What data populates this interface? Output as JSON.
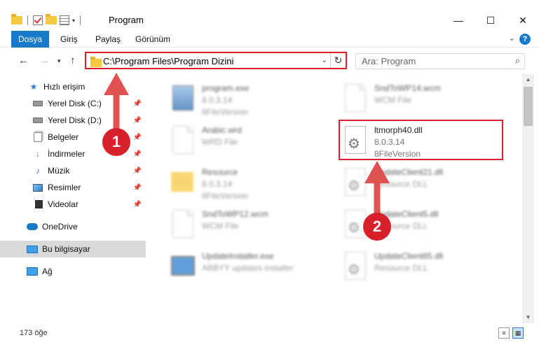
{
  "window": {
    "title": "Program"
  },
  "ribbon": {
    "tabs": [
      "Dosya",
      "Giriş",
      "Paylaş",
      "Görünüm"
    ],
    "help": "?"
  },
  "address": {
    "path": "C:\\Program Files\\Program Dizini"
  },
  "search": {
    "placeholder": "Ara: Program"
  },
  "sidebar": {
    "items": [
      {
        "label": "Hızlı erişim",
        "icon": "star-icon"
      },
      {
        "label": "Yerel Disk (C:)",
        "icon": "drive-icon",
        "pinned": true
      },
      {
        "label": "Yerel Disk (D:)",
        "icon": "drive-icon",
        "pinned": true
      },
      {
        "label": "Belgeler",
        "icon": "documents-icon",
        "pinned": true
      },
      {
        "label": "İndirmeler",
        "icon": "download-icon",
        "pinned": true
      },
      {
        "label": "Müzik",
        "icon": "music-icon",
        "pinned": true
      },
      {
        "label": "Resimler",
        "icon": "pictures-icon",
        "pinned": true
      },
      {
        "label": "Videolar",
        "icon": "videos-icon",
        "pinned": true
      },
      {
        "label": "OneDrive",
        "icon": "cloud-icon"
      },
      {
        "label": "Bu bilgisayar",
        "icon": "computer-icon",
        "selected": true
      },
      {
        "label": "Ağ",
        "icon": "network-icon"
      }
    ]
  },
  "files": [
    {
      "name": "program.exe",
      "line2": "8.0.3.14",
      "line3": "8FileVersion"
    },
    {
      "name": "SndToWP14.wcm",
      "line2": "WCM File",
      "line3": ""
    },
    {
      "name": "Arabic.wrd",
      "line2": "WRD File",
      "line3": ""
    },
    {
      "name": "ltmorph40.dll",
      "line2": "8.0.3.14",
      "line3": "8FileVersion"
    },
    {
      "name": "Resource",
      "line2": "8.0.3.14",
      "line3": "8FileVersion"
    },
    {
      "name": "UpdateClient21.dll",
      "line2": "Resource DLL",
      "line3": ""
    },
    {
      "name": "SndToWP12.wcm",
      "line2": "WCM File",
      "line3": ""
    },
    {
      "name": "UpdateClient5.dll",
      "line2": "Resource DLL",
      "line3": ""
    },
    {
      "name": "UpdateInstaller.exe",
      "line2": "ABBYY updates installer",
      "line3": ""
    },
    {
      "name": "UpdateClient65.dll",
      "line2": "Resource DLL",
      "line3": ""
    }
  ],
  "status": {
    "count": "173 öğe"
  },
  "annotations": {
    "step1": "1",
    "step2": "2",
    "accent": "#d8202a"
  }
}
